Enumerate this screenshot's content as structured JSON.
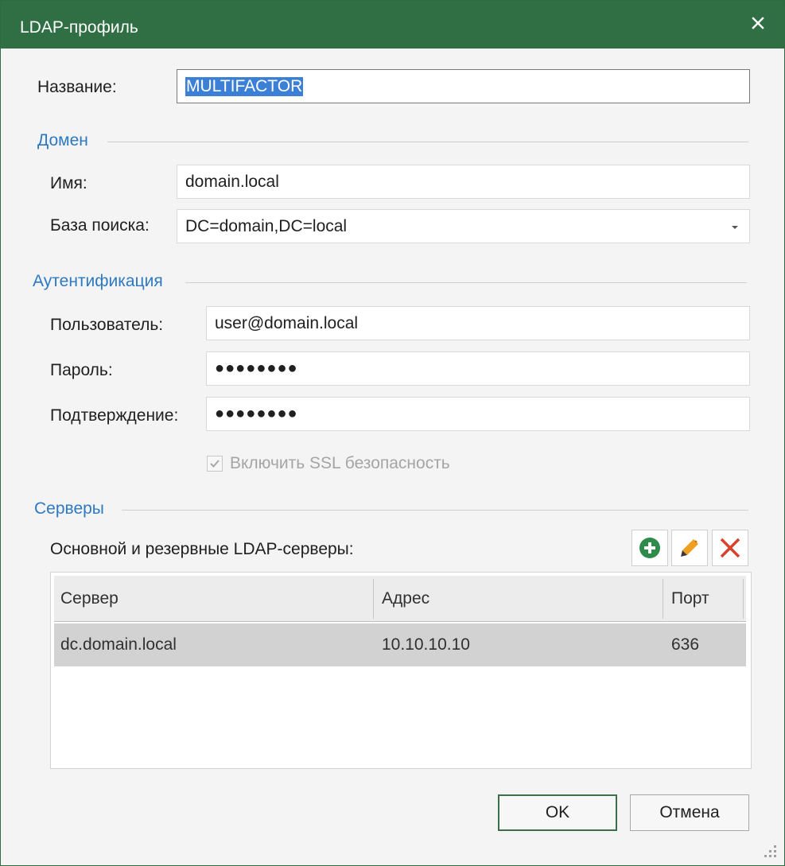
{
  "window": {
    "title": "LDAP-профиль"
  },
  "form": {
    "name_label": "Название:",
    "name_value": "MULTIFACTOR"
  },
  "domain": {
    "section_title": "Домен",
    "name_label": "Имя:",
    "name_value": "domain.local",
    "search_base_label": "База поиска:",
    "search_base_value": "DC=domain,DC=local"
  },
  "auth": {
    "section_title": "Аутентификация",
    "user_label": "Пользователь:",
    "user_value": "user@domain.local",
    "password_label": "Пароль:",
    "password_value": "●●●●●●●●",
    "confirm_label": "Подтверждение:",
    "confirm_value": "●●●●●●●●",
    "ssl_label": "Включить SSL безопасность",
    "ssl_checked": true
  },
  "servers": {
    "section_title": "Серверы",
    "list_label": "Основной и резервные LDAP-серверы:",
    "columns": [
      "Сервер",
      "Адрес",
      "Порт"
    ],
    "rows": [
      {
        "server": "dc.domain.local",
        "address": "10.10.10.10",
        "port": "636"
      }
    ],
    "tools": [
      "add-icon",
      "edit-icon",
      "delete-icon"
    ]
  },
  "buttons": {
    "ok": "OK",
    "cancel": "Отмена"
  },
  "colors": {
    "titlebar": "#2f6f43",
    "section": "#2e79c2",
    "selection": "#3b7fd6",
    "add": "#2e8b4a",
    "delete": "#d9412b"
  }
}
